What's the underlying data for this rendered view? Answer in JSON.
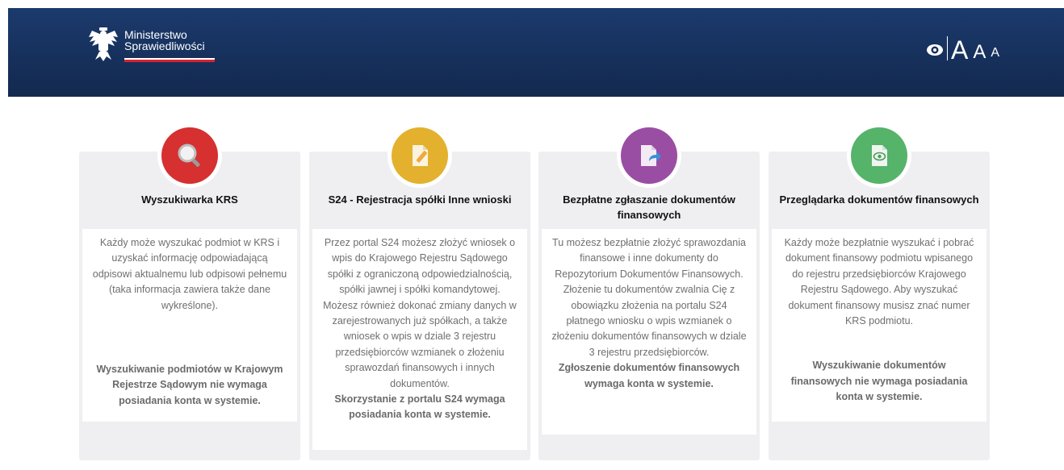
{
  "header": {
    "logo_line1": "Ministerstwo",
    "logo_line2": "Sprawiedliwości",
    "access": {
      "big": "A",
      "mid": "A",
      "small": "A",
      "contrast_icon": "eye-icon"
    },
    "colors": {
      "bar": "#1b3a6d",
      "flag_red": "#d9232e"
    }
  },
  "cards": [
    {
      "icon": "search-icon",
      "color": "#d63030",
      "title": "Wyszukiwarka KRS",
      "text": "Każdy może wyszukać podmiot w KRS i uzyskać informację odpowiadającą odpisowi aktualnemu lub odpisowi pełnemu (taka informacja zawiera także dane wykreślone).",
      "note": "Wyszukiwanie podmiotów w Krajowym Rejestrze Sądowym nie wymaga posiadania konta w systemie."
    },
    {
      "icon": "edit-document-icon",
      "color": "#e4b12e",
      "title": "S24 - Rejestracja spółki Inne wnioski",
      "text": "Przez portal S24 możesz złożyć wniosek o wpis do Krajowego Rejestru Sądowego spółki z ograniczoną odpowiedzialnością, spółki jawnej i spółki komandytowej. Możesz również dokonać zmiany danych w zarejestrowanych już spółkach, a także wniosek o wpis w dziale 3 rejestru przedsiębiorców wzmianek o złożeniu sprawozdań finansowych i innych dokumentów.",
      "note": "Skorzystanie z portalu S24 wymaga posiadania konta w systemie."
    },
    {
      "icon": "send-document-icon",
      "color": "#9a4ea3",
      "title": "Bezpłatne zgłaszanie dokumentów finansowych",
      "text": "Tu możesz bezpłatnie złożyć sprawozdania finansowe i inne dokumenty do Repozytorium Dokumentów Finansowych. Złożenie tu dokumentów zwalnia Cię z obowiązku złożenia na portalu S24 płatnego wniosku o wpis wzmianek o złożeniu dokumentów finansowych w dziale 3 rejestru przedsiębiorców.",
      "note": "Zgłoszenie dokumentów finansowych wymaga konta w systemie."
    },
    {
      "icon": "view-document-icon",
      "color": "#56b36a",
      "title": "Przeglądarka dokumentów finansowych",
      "text": "Każdy może bezpłatnie wyszukać i pobrać dokument finansowy podmiotu wpisanego do rejestru przedsiębiorców Krajowego Rejestru Sądowego. Aby wyszukać dokument finansowy musisz znać numer KRS podmiotu.",
      "note": "Wyszukiwanie dokumentów finansowych nie wymaga posiadania konta w systemie."
    }
  ]
}
